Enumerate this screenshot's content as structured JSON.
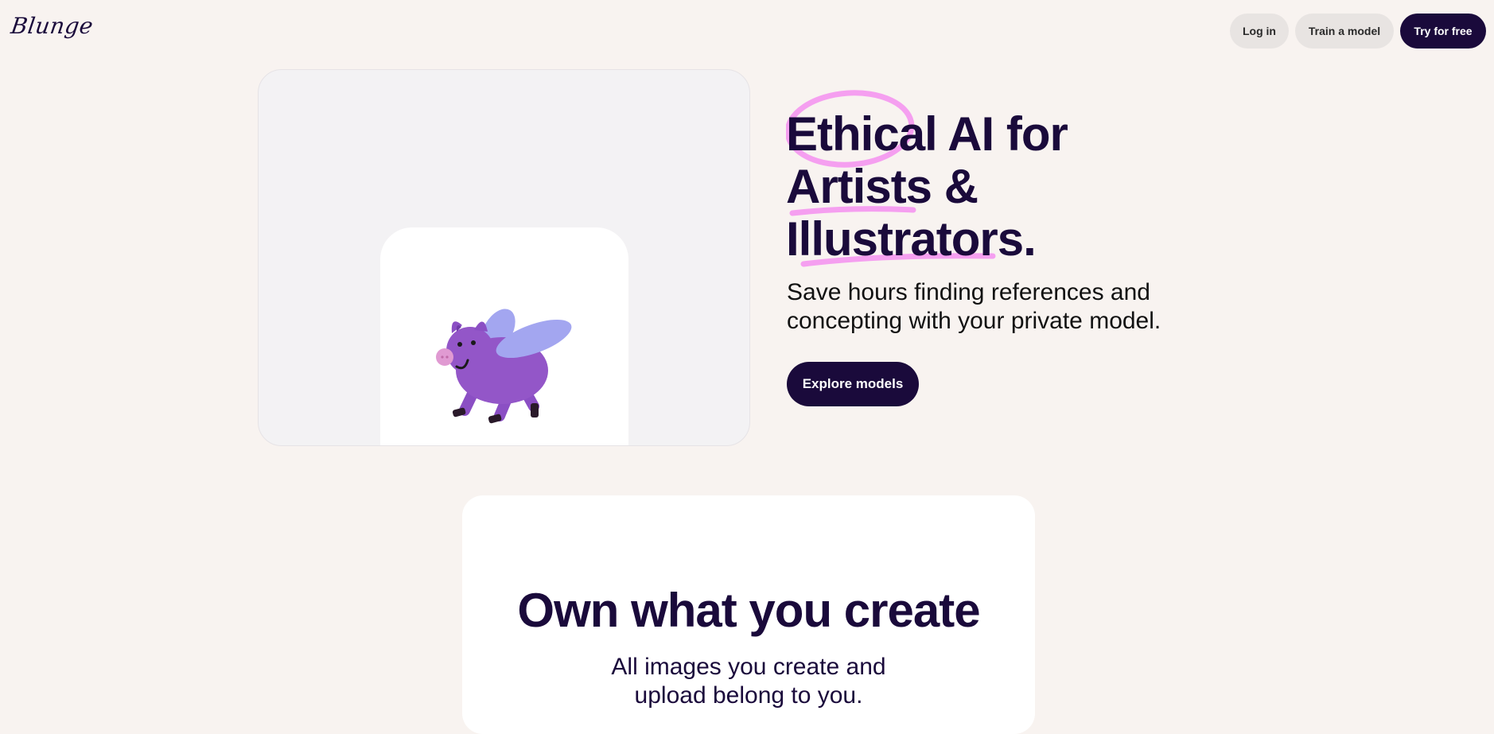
{
  "brand": {
    "logo_text": "Blunge"
  },
  "nav": {
    "login_label": "Log in",
    "train_label": "Train a model",
    "try_label": "Try for free"
  },
  "hero": {
    "title_line1_word1": "Ethical",
    "title_line1_rest": " AI for",
    "title_line2_word1": "Artists",
    "title_line2_rest": " &",
    "title_line3_word1": "Illustrators",
    "title_line3_rest": ".",
    "subtitle": "Save hours finding references and concepting with your private model.",
    "cta_label": "Explore models",
    "image_icon": "flying-pig-illustration",
    "accent_color": "#f58ff0"
  },
  "own": {
    "title": "Own what you create",
    "subtitle": "All images you create and upload belong to you."
  },
  "colors": {
    "background": "#f8f3f0",
    "primary": "#1a0a3b",
    "light_pill": "#e8e4e2",
    "card": "#ffffff"
  }
}
